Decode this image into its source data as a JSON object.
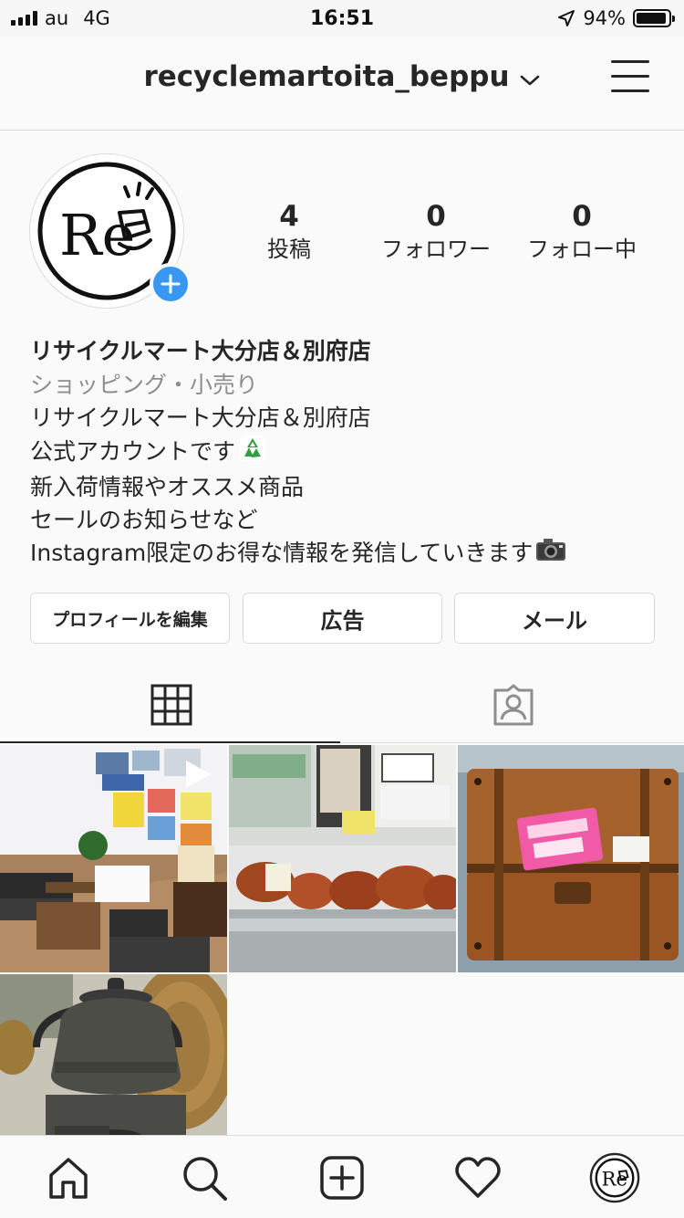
{
  "status_bar": {
    "carrier": "au",
    "network": "4G",
    "time": "16:51",
    "battery": "94%",
    "battery_level": 0.94
  },
  "header": {
    "username": "recyclemartoita_beppu",
    "icons": [
      "chevron-down-icon",
      "hamburger-menu-icon"
    ]
  },
  "profile": {
    "avatar_logo_text": "Re",
    "stats": [
      {
        "value": "4",
        "label": "投稿"
      },
      {
        "value": "0",
        "label": "フォロワー"
      },
      {
        "value": "0",
        "label": "フォロー中"
      }
    ],
    "name": "リサイクルマート大分店＆別府店",
    "category": "ショッピング・小売り",
    "bio_lines": [
      "リサイクルマート大分店＆別府店",
      "公式アカウントです",
      "新入荷情報やオススメ商品",
      "セールのお知らせなど",
      "Instagram限定のお得な情報を発信していきます"
    ],
    "bio_emojis": [
      "recycle-emoji",
      "camera-emoji"
    ]
  },
  "buttons": {
    "edit_profile": "プロフィールを編集",
    "promotions": "広告",
    "email": "メール"
  },
  "tabs": {
    "items": [
      "grid-icon",
      "tagged-icon"
    ],
    "active": "grid"
  },
  "posts": [
    {
      "name": "post-shop-interior",
      "video": true
    },
    {
      "name": "post-wooden-carvings",
      "video": false
    },
    {
      "name": "post-trunk-chest",
      "video": false
    },
    {
      "name": "post-iron-kettle",
      "video": false
    }
  ],
  "bottom_nav": {
    "items": [
      "home-icon",
      "search-icon",
      "new-post-icon",
      "activity-heart-icon",
      "profile-avatar-icon"
    ]
  },
  "colors": {
    "accent_blue": "#3897f0",
    "text": "#262626",
    "secondary_text": "#8e8e8e",
    "border": "#dbdbdb"
  }
}
